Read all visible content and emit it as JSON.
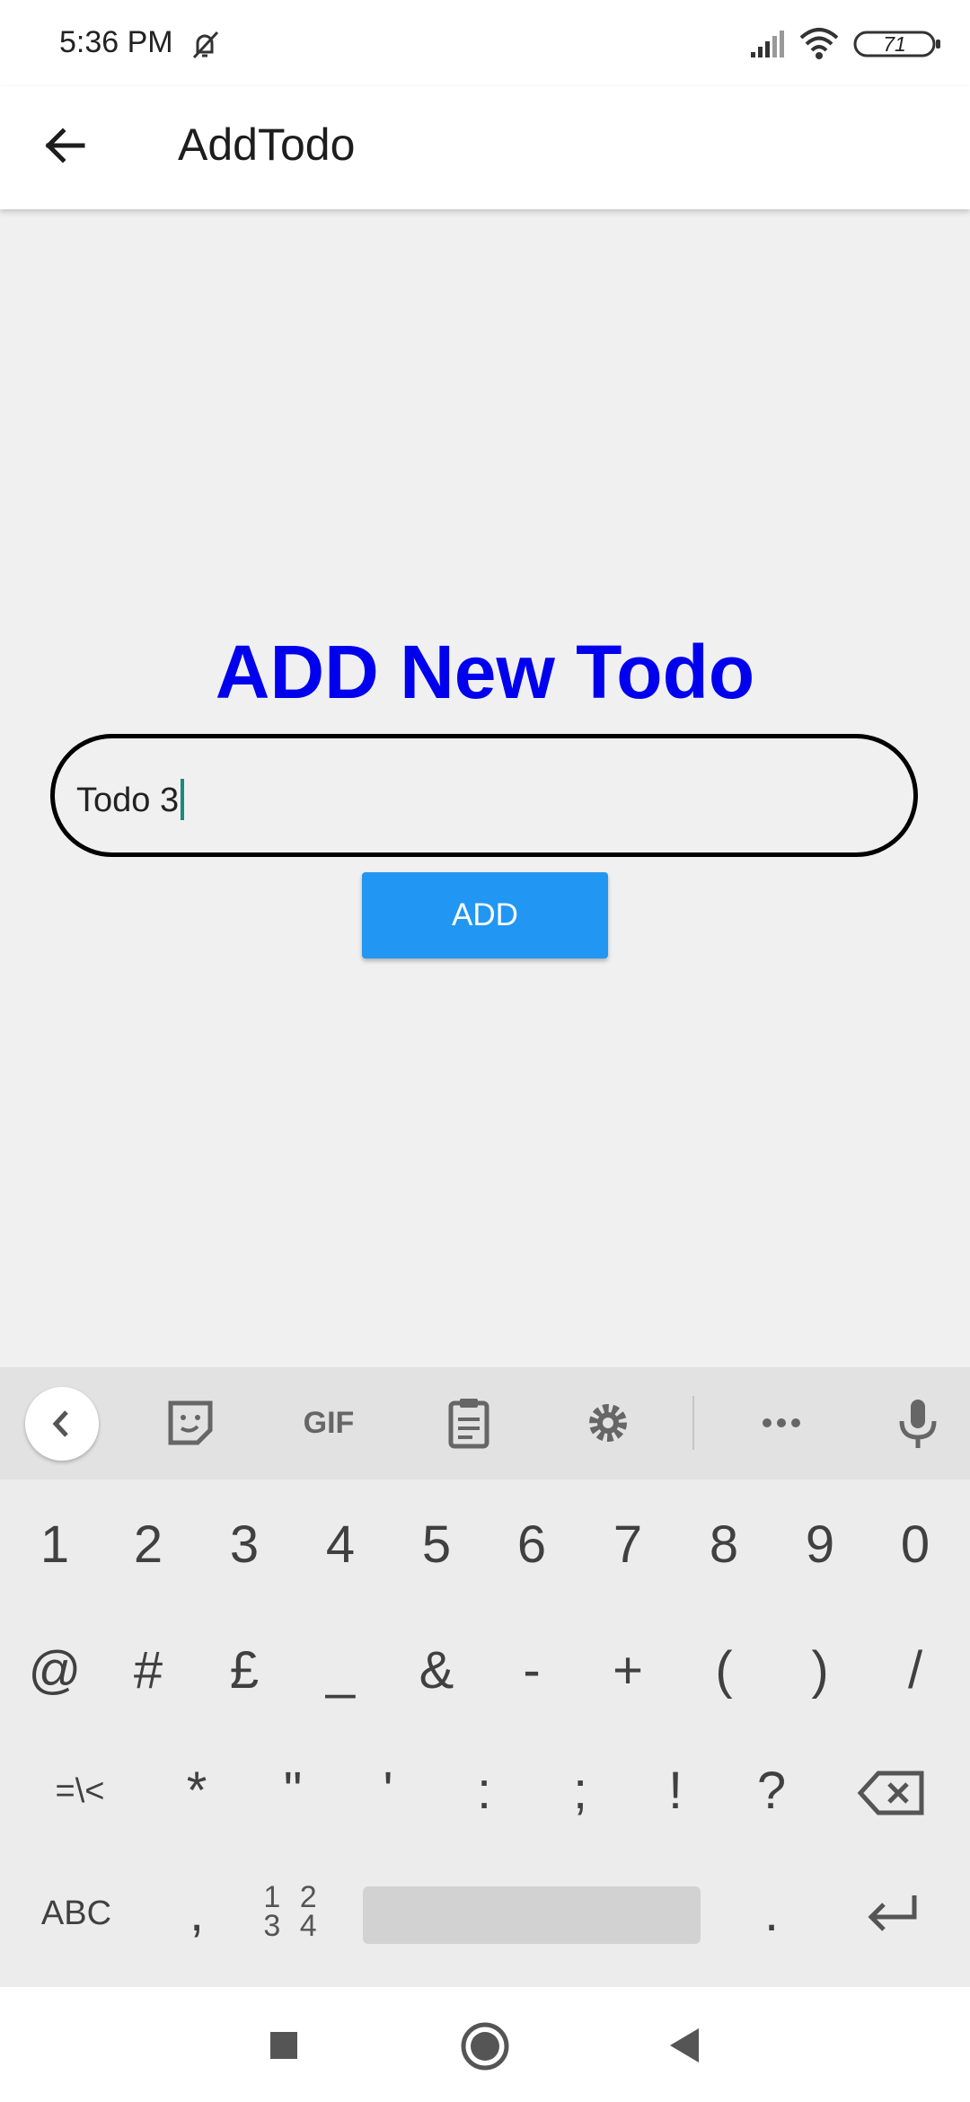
{
  "status_bar": {
    "time": "5:36 PM",
    "battery": "71",
    "icons": [
      "mute-icon",
      "signal-icon",
      "wifi-icon",
      "battery-icon"
    ]
  },
  "app_bar": {
    "title": "AddTodo",
    "back_icon": "arrow-left-icon"
  },
  "main": {
    "heading": "ADD New Todo",
    "heading_color": "#0000ee",
    "todo_input": {
      "value": "Todo 3"
    },
    "add_button": {
      "label": "ADD",
      "color": "#2196f3"
    }
  },
  "keyboard": {
    "toolbar": [
      "chevron-left-icon",
      "sticker-icon",
      "gif-icon",
      "clipboard-icon",
      "gear-icon",
      "more-icon",
      "microphone-icon"
    ],
    "gif_label": "GIF",
    "row1": [
      "1",
      "2",
      "3",
      "4",
      "5",
      "6",
      "7",
      "8",
      "9",
      "0"
    ],
    "row2": [
      "@",
      "#",
      "£",
      "_",
      "&",
      "-",
      "+",
      "(",
      ")",
      "/"
    ],
    "row3": [
      "=\\<",
      "*",
      "\"",
      "'",
      ":",
      ";",
      "!",
      "?"
    ],
    "row4": {
      "abc": "ABC",
      "comma": ",",
      "numpad": "1 2\n3 4",
      "period": "."
    }
  },
  "nav_bar": [
    "recents-square-icon",
    "home-circle-icon",
    "back-triangle-icon"
  ]
}
